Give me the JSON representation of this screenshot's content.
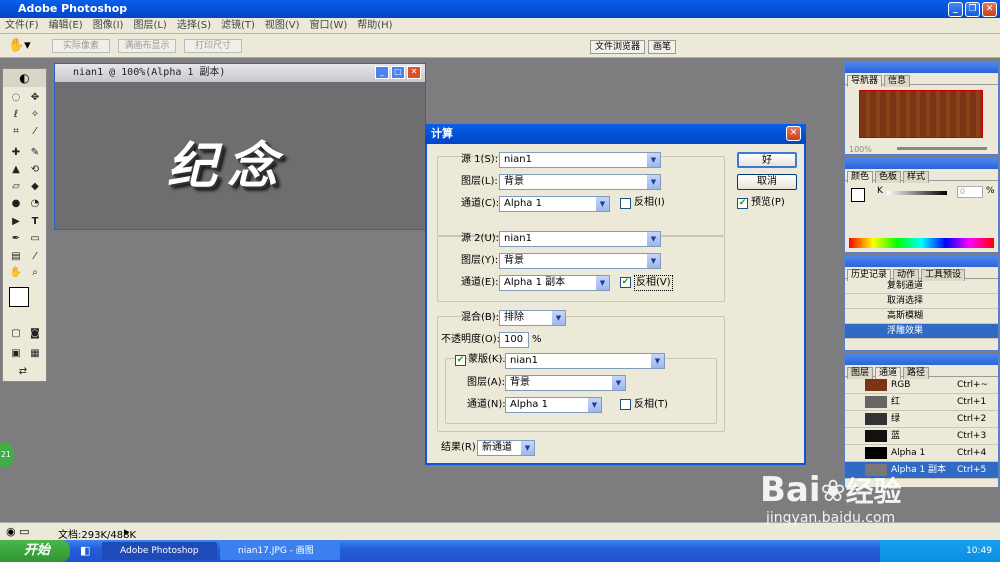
{
  "app": {
    "title": "Adobe Photoshop"
  },
  "menu": [
    "文件(F)",
    "编辑(E)",
    "图像(I)",
    "图层(L)",
    "选择(S)",
    "滤镜(T)",
    "视图(V)",
    "窗口(W)",
    "帮助(H)"
  ],
  "options": {
    "actual_pixels": "实际像素",
    "fit_screen": "满画布显示",
    "print_size": "打印尺寸",
    "file_browser": "文件浏览器",
    "brushes": "画笔"
  },
  "document": {
    "title": "nian1 @ 100%(Alpha 1 副本)",
    "text": "纪念"
  },
  "dialog": {
    "title": "计算",
    "source1": {
      "label": "源 1(S):",
      "value": "nian1",
      "layer_label": "图层(L):",
      "layer": "背景",
      "channel_label": "通道(C):",
      "channel": "Alpha 1",
      "invert_label": "反相(I)",
      "invert": false
    },
    "source2": {
      "label": "源 2(U):",
      "value": "nian1",
      "layer_label": "图层(Y):",
      "layer": "背景",
      "channel_label": "通道(E):",
      "channel": "Alpha 1 副本",
      "invert_label": "反相(V)",
      "invert": true
    },
    "blend": {
      "label": "混合(B):",
      "value": "排除",
      "opacity_label": "不透明度(O):",
      "opacity": "100",
      "percent": "%"
    },
    "mask": {
      "label": "蒙版(K)...",
      "value": "nian1",
      "layer_label": "图层(A):",
      "layer": "背景",
      "channel_label": "通道(N):",
      "channel": "Alpha 1",
      "invert_label": "反相(T)",
      "checked": true
    },
    "result": {
      "label": "结果(R):",
      "value": "新通道"
    },
    "ok": "好",
    "cancel": "取消",
    "preview": "预览(P)"
  },
  "panels": {
    "navigator": {
      "tabs": [
        "导航器",
        "信息"
      ],
      "zoom": "100%"
    },
    "color": {
      "tabs": [
        "颜色",
        "色板",
        "样式"
      ],
      "k_label": "K",
      "k_value": "0",
      "percent": "%"
    },
    "history": {
      "tabs": [
        "历史记录",
        "动作",
        "工具预设"
      ],
      "items": [
        "复制通道",
        "取消选择",
        "高斯模糊",
        "浮雕效果"
      ]
    },
    "channels": {
      "tabs": [
        "图层",
        "通道",
        "路径"
      ],
      "rows": [
        {
          "name": "RGB",
          "key": "Ctrl+~"
        },
        {
          "name": "红",
          "key": "Ctrl+1"
        },
        {
          "name": "绿",
          "key": "Ctrl+2"
        },
        {
          "name": "蓝",
          "key": "Ctrl+3"
        },
        {
          "name": "Alpha 1",
          "key": "Ctrl+4"
        },
        {
          "name": "Alpha 1 副本",
          "key": "Ctrl+5"
        }
      ]
    }
  },
  "status": {
    "doc": "文档:293K/488K"
  },
  "taskbar": {
    "start": "开始",
    "items": [
      "Adobe Photoshop",
      "nian17.JPG - 画图"
    ],
    "time": "10:49"
  },
  "badge": "21",
  "watermark": {
    "brand": "Bai",
    "brand2": "经验",
    "url": "jingyan.baidu.com"
  }
}
